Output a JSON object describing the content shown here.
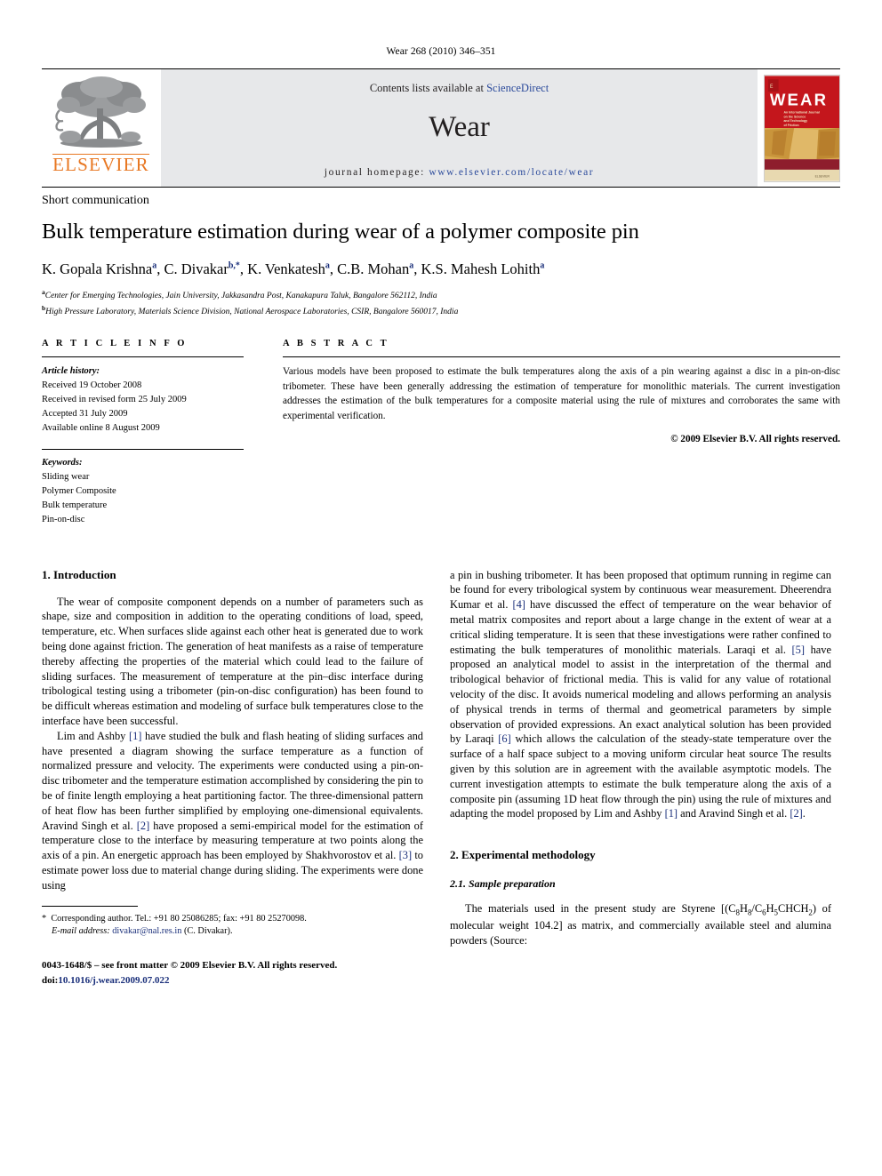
{
  "running_head": "Wear 268 (2010) 346–351",
  "masthead": {
    "publisher_name": "ELSEVIER",
    "contents_prefix": "Contents lists available at ",
    "contents_link": "ScienceDirect",
    "journal_title": "Wear",
    "homepage_prefix": "journal homepage: ",
    "homepage_url": "www.elsevier.com/locate/wear",
    "cover": {
      "title": "WEAR",
      "subtitle": "An International Journal on the Science and Technology of Friction Lubrication and Wear",
      "brand": "ELSEVIER",
      "top_color": "#c4161c",
      "band_color": "#8e1d2c",
      "sand_color": "#e0b868"
    }
  },
  "article": {
    "doctype": "Short communication",
    "title": "Bulk temperature estimation during wear of a polymer composite pin",
    "authors_html": "K. Gopala Krishna<sup>a</sup>, C. Divakar<sup>b,*</sup>, K. Venkatesh<sup>a</sup>, C.B. Mohan<sup>a</sup>, K.S. Mahesh Lohith<sup>a</sup>",
    "affiliations": [
      {
        "marker": "a",
        "text": "Center for Emerging Technologies, Jain University, Jakkasandra Post, Kanakapura Taluk, Bangalore 562112, India"
      },
      {
        "marker": "b",
        "text": "High Pressure Laboratory, Materials Science Division, National Aerospace Laboratories, CSIR, Bangalore 560017, India"
      }
    ]
  },
  "article_info": {
    "heading": "A R T I C L E    I N F O",
    "history_label": "Article history:",
    "history": [
      "Received 19 October 2008",
      "Received in revised form 25 July 2009",
      "Accepted 31 July 2009",
      "Available online 8 August 2009"
    ],
    "keywords_label": "Keywords:",
    "keywords": [
      "Sliding wear",
      "Polymer Composite",
      "Bulk temperature",
      "Pin-on-disc"
    ]
  },
  "abstract": {
    "heading": "A B S T R A C T",
    "text": "Various models have been proposed to estimate the bulk temperatures along the axis of a pin wearing against a disc in a pin-on-disc tribometer. These have been generally addressing the estimation of temperature for monolithic materials. The current investigation addresses the estimation of the bulk temperatures for a composite material using the rule of mixtures and corroborates the same with experimental verification.",
    "copyright": "© 2009 Elsevier B.V. All rights reserved."
  },
  "sections": {
    "introduction_heading": "1.  Introduction",
    "experimental_heading": "2.  Experimental methodology",
    "sample_prep_heading": "2.1.  Sample preparation"
  },
  "left_column": {
    "para1": "The wear of composite component depends on a number of parameters such as shape, size and composition in addition to the operating conditions of load, speed, temperature, etc. When surfaces slide against each other heat is generated due to work being done against friction. The generation of heat manifests as a raise of temperature thereby affecting the properties of the material which could lead to the failure of sliding surfaces. The measurement of temperature at the pin–disc interface during tribological testing using a tribometer (pin-on-disc configuration) has been found to be difficult whereas estimation and modeling of surface bulk temperatures close to the interface have been successful.",
    "para2_a": "Lim and Ashby ",
    "para2_ref1": "[1]",
    "para2_b": " have studied the bulk and flash heating of sliding surfaces and have presented a diagram showing the surface temperature as a function of normalized pressure and velocity. The experiments were conducted using a pin-on-disc tribometer and the temperature estimation accomplished by considering the pin to be of finite length employing a heat partitioning factor. The three-dimensional pattern of heat flow has been further simplified by employing one-dimensional equivalents. Aravind Singh et al. ",
    "para2_ref2": "[2]",
    "para2_c": " have proposed a semi-empirical model for the estimation of temperature close to the interface by measuring temperature at two points along the axis of a pin. An energetic approach has been employed by Shakhvorostov et al. ",
    "para2_ref3": "[3]",
    "para2_d": " to estimate power loss due to material change during sliding. The experiments were done using"
  },
  "right_column": {
    "para_a": "a pin in bushing tribometer. It has been proposed that optimum running in regime can be found for every tribological system by continuous wear measurement. Dheerendra Kumar et al. ",
    "ref4": "[4]",
    "para_b": " have discussed the effect of temperature on the wear behavior of metal matrix composites and report about a large change in the extent of wear at a critical sliding temperature. It is seen that these investigations were rather confined to estimating the bulk temperatures of monolithic materials. Laraqi et al. ",
    "ref5": "[5]",
    "para_c": " have proposed an analytical model to assist in the interpretation of the thermal and tribological behavior of frictional media. This is valid for any value of rotational velocity of the disc. It avoids numerical modeling and allows performing an analysis of physical trends in terms of thermal and geometrical parameters by simple observation of provided expressions. An exact analytical solution has been provided by Laraqi ",
    "ref6": "[6]",
    "para_d": " which allows the calculation of the steady-state temperature over the surface of a half space subject to a moving uniform circular heat source The results given by this solution are in agreement with the available asymptotic models. The current investigation attempts to estimate the bulk temperature along the axis of a composite pin (assuming 1D heat flow through the pin) using the rule of mixtures and adapting the model proposed by Lim and Ashby ",
    "ref1": "[1]",
    "para_e": " and Aravind Singh et al. ",
    "ref2": "[2]",
    "para_f": ".",
    "sample_prep_a": "The materials used in the present study are Styrene [(C",
    "sub1": "8",
    "sample_prep_b": "H",
    "sub2": "8",
    "sample_prep_c": "/C",
    "sub3": "6",
    "sample_prep_d": "H",
    "sub4": "5",
    "sample_prep_e": "CHCH",
    "sub5": "2",
    "sample_prep_f": ") of molecular weight 104.2] as matrix, and commercially available steel and alumina powders (Source:"
  },
  "footer": {
    "corresponding_marker": "*",
    "corresponding_text": "Corresponding author. Tel.: +91 80 25086285; fax: +91 80 25270098.",
    "email_label": "E-mail address:",
    "email": "divakar@nal.res.in",
    "email_suffix": " (C. Divakar).",
    "issn_line": "0043-1648/$ – see front matter © 2009 Elsevier B.V. All rights reserved.",
    "doi_label": "doi:",
    "doi_value": "10.1016/j.wear.2009.07.022"
  }
}
